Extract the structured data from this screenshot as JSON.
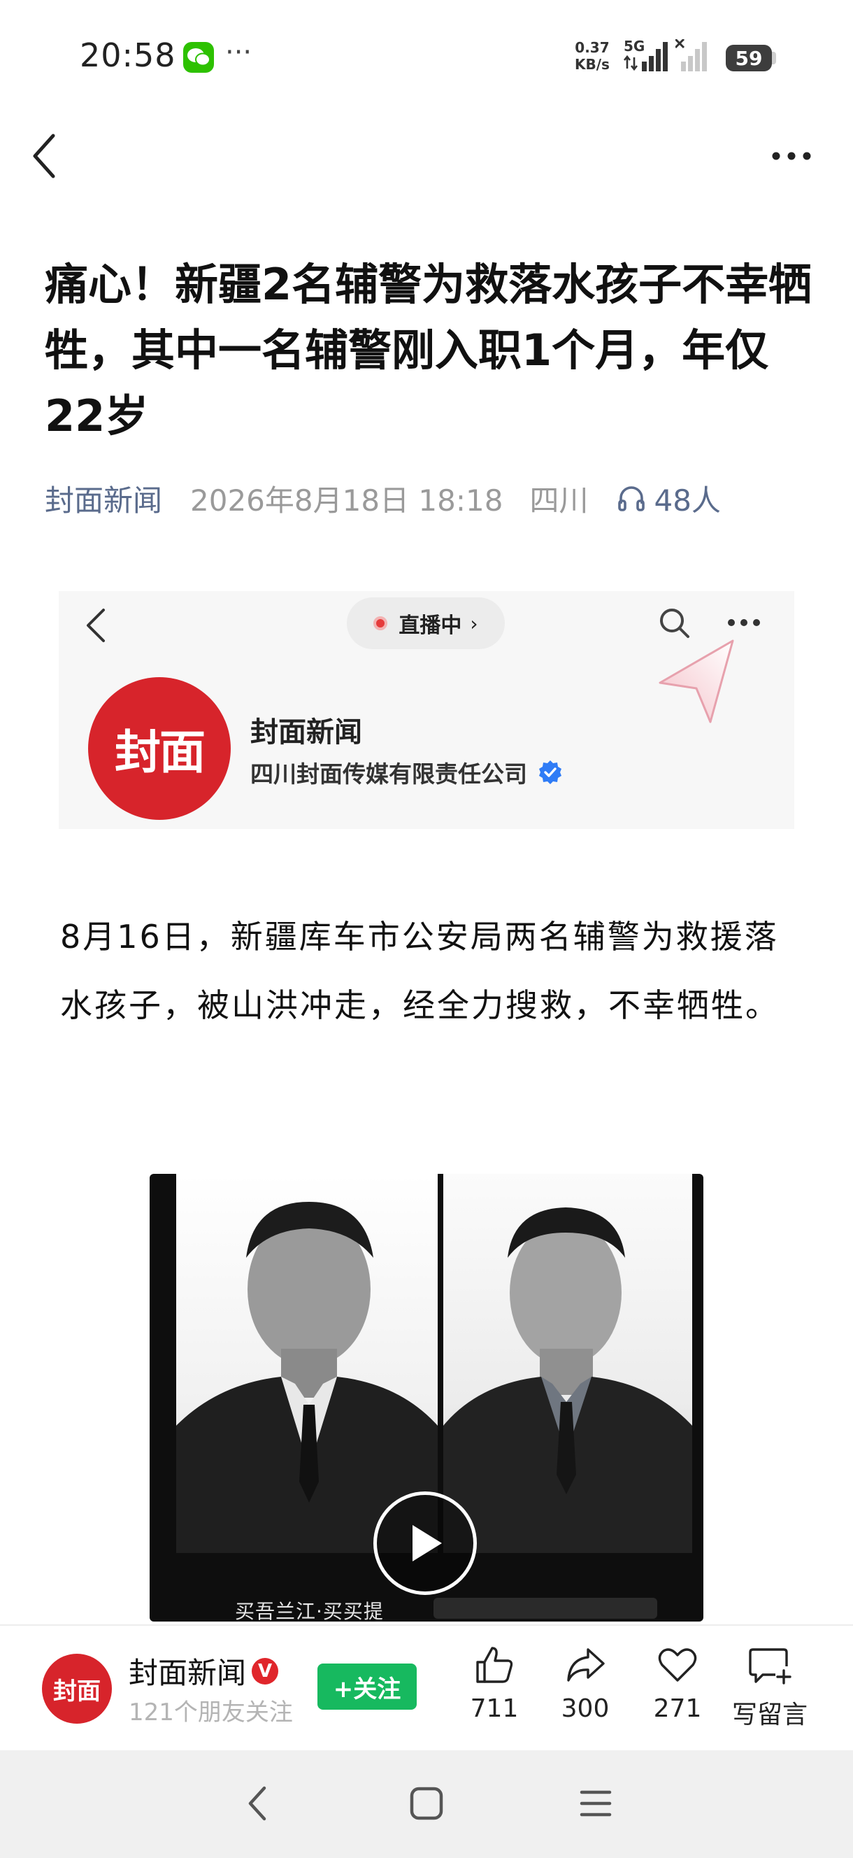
{
  "status_bar": {
    "time": "20:58",
    "more": "···",
    "speed_value": "0.37",
    "speed_unit": "KB/s",
    "network": "5G",
    "battery": "59",
    "icons": [
      "wechat-icon",
      "wifi-arrows-icon",
      "signal-icon",
      "no-signal-icon"
    ]
  },
  "nav": {
    "back_icon": "chevron-left-icon",
    "more_icon": "more-icon"
  },
  "article": {
    "title": "痛心！新疆2名辅警为救落水孩子不幸牺牲，其中一名辅警刚入职1个月，年仅22岁",
    "source": "封面新闻",
    "date": "2026年8月18日 18:18",
    "region": "四川",
    "listeners": "48人",
    "body": "8月16日，新疆库车市公安局两名辅警为救援落水孩子，被山洪冲走，经全力搜救，不幸牺牲。"
  },
  "embed": {
    "live_label": "直播中",
    "logo_text": "封面",
    "name": "封面新闻",
    "company": "四川封面传媒有限责任公司"
  },
  "video": {
    "caption": "买吾兰江·买买提"
  },
  "action_bar": {
    "logo_text": "封面",
    "name": "封面新闻",
    "verified_badge": "V",
    "friends": "121个朋友关注",
    "follow_label": "+关注",
    "likes": "711",
    "shares": "300",
    "favorites": "271",
    "comment_label": "写留言"
  },
  "colors": {
    "brand_red": "#d7242b",
    "follow_green": "#17b95f",
    "source_blue": "#5a6b8c",
    "meta_gray": "#9a9a9a"
  }
}
